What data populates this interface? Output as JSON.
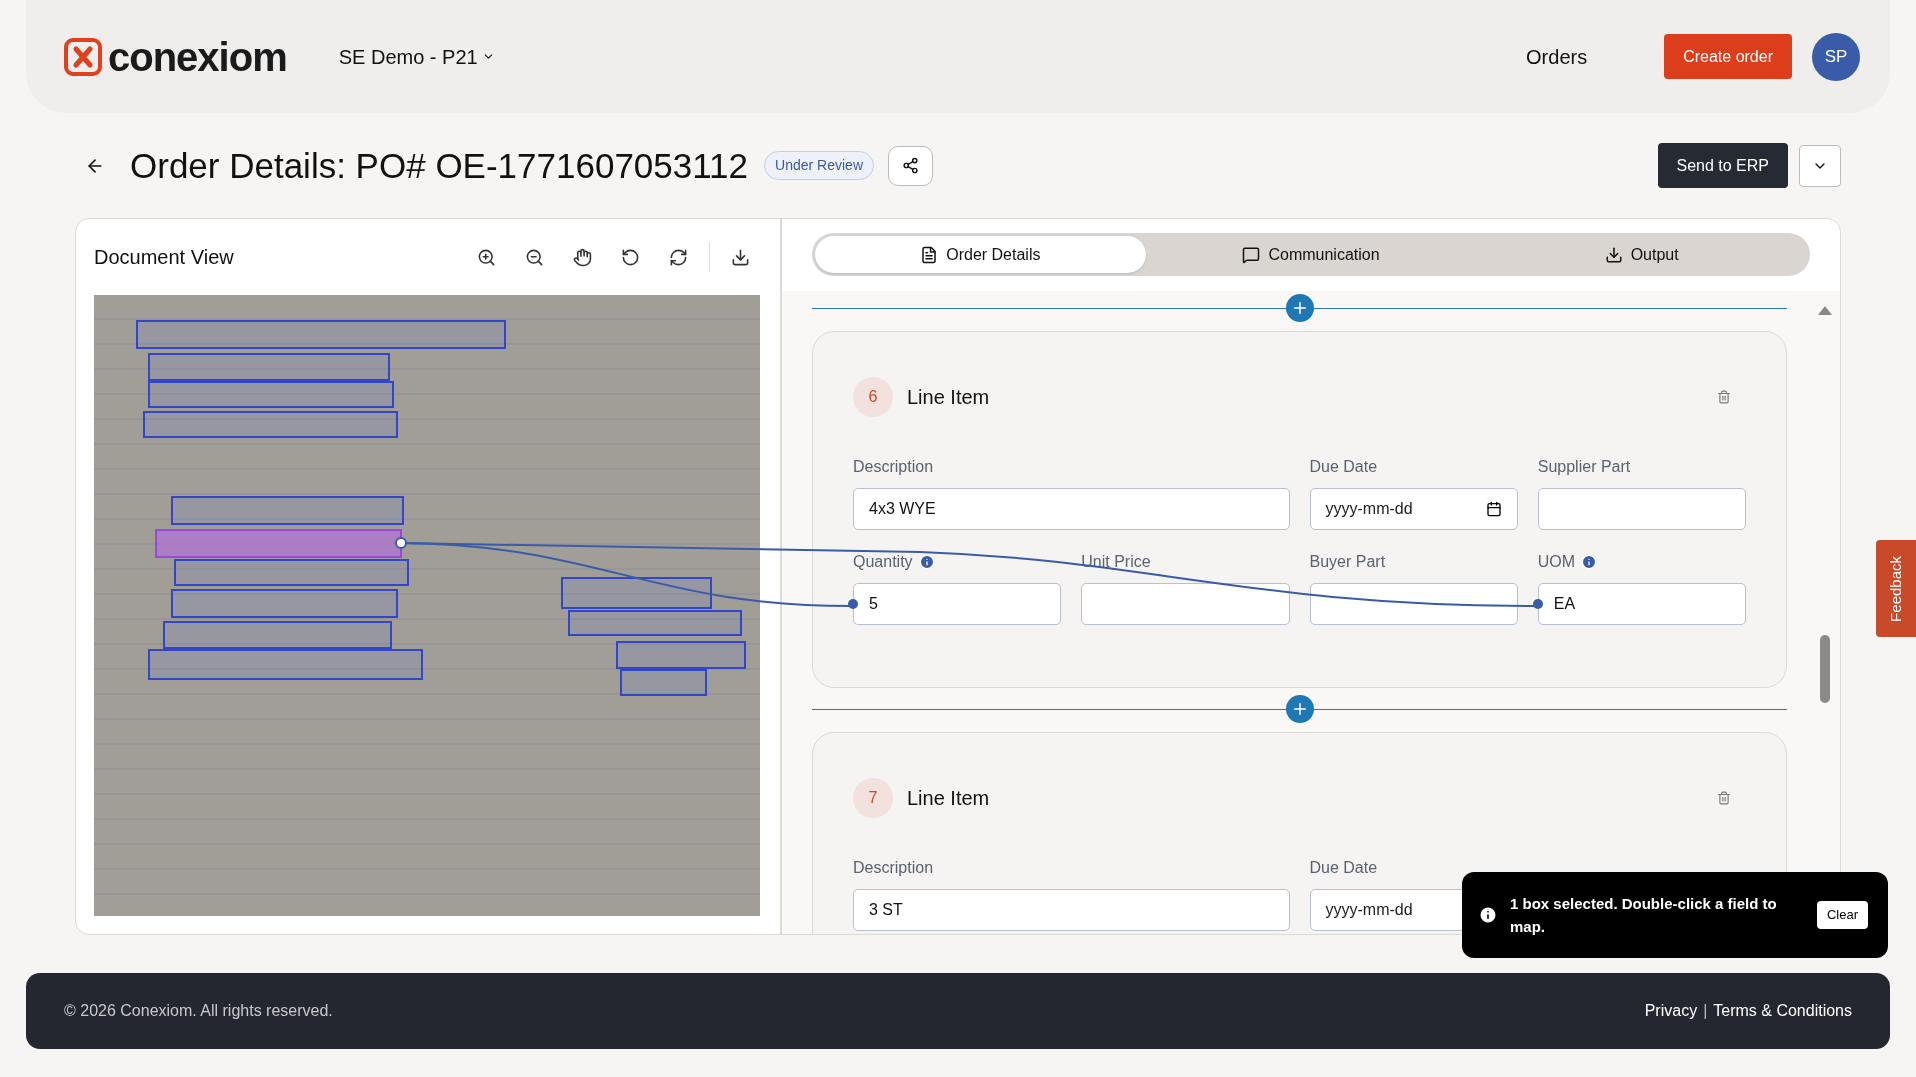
{
  "header": {
    "brand": "conexiom",
    "workspace": "SE Demo - P21",
    "nav": "Orders",
    "create_button": "Create order",
    "avatar": "SP"
  },
  "page": {
    "title": "Order Details: PO# OE-1771607053112",
    "status": "Under Review",
    "send_button": "Send to ERP"
  },
  "document_view": {
    "title": "Document View",
    "boxes": [
      {
        "selected": false
      },
      {
        "selected": false
      },
      {
        "selected": false
      },
      {
        "selected": false
      },
      {
        "selected": false
      },
      {
        "selected": true
      },
      {
        "selected": false
      },
      {
        "selected": false
      },
      {
        "selected": false
      },
      {
        "selected": false
      },
      {
        "selected": false
      },
      {
        "selected": false
      },
      {
        "selected": false
      },
      {
        "selected": false
      }
    ]
  },
  "tabs": [
    {
      "label": "Order Details",
      "selected": true,
      "kind": "document"
    },
    {
      "label": "Communication",
      "selected": false,
      "kind": "chat"
    },
    {
      "label": "Output",
      "selected": false,
      "kind": "download"
    }
  ],
  "line_items": [
    {
      "number": "6",
      "title": "Line Item",
      "fields": [
        {
          "label": "Description",
          "value": "4x3 WYE",
          "kind": "text"
        },
        {
          "label": "Due Date",
          "placeholder": "yyyy-mm-dd",
          "kind": "date"
        },
        {
          "label": "Supplier Part",
          "kind": "text"
        },
        {
          "label": "Quantity",
          "value": "5",
          "kind": "text",
          "info": true,
          "mapped": true
        },
        {
          "label": "Unit Price",
          "kind": "text"
        },
        {
          "label": "Buyer Part",
          "kind": "text"
        },
        {
          "label": "UOM",
          "value": "EA",
          "kind": "text",
          "info": true,
          "mapped": true
        }
      ]
    },
    {
      "number": "7",
      "title": "Line Item",
      "fields": [
        {
          "label": "Description",
          "value": "3 ST",
          "kind": "text"
        },
        {
          "label": "Due Date",
          "placeholder": "yyyy-mm-dd",
          "kind": "date"
        }
      ]
    }
  ],
  "toast": {
    "message": "1 box selected. Double-click a field to map.",
    "button": "Clear"
  },
  "feedback": "Feedback",
  "footer": {
    "copyright": "© 2026 Conexiom. All rights reserved.",
    "links": [
      "Privacy",
      "Terms & Conditions"
    ],
    "separator": "|"
  }
}
